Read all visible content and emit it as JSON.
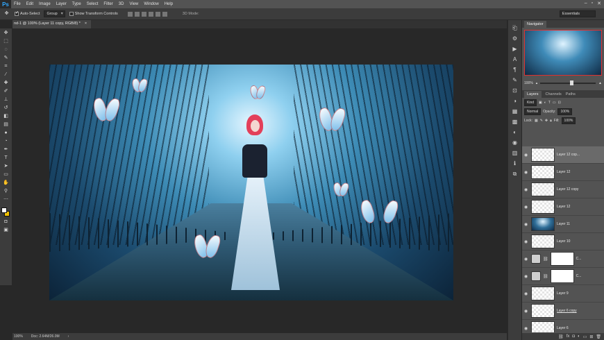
{
  "app": {
    "logo": "Ps",
    "menu": [
      "File",
      "Edit",
      "Image",
      "Layer",
      "Type",
      "Select",
      "Filter",
      "3D",
      "View",
      "Window",
      "Help"
    ],
    "window_controls": [
      "–",
      "▫",
      "✕"
    ]
  },
  "options_bar": {
    "auto_select_label": "Auto-Select",
    "auto_select_mode": "Group",
    "show_transform_label": "Show Transform Controls",
    "mode_3d_label": "3D Mode:",
    "workspace": "Essentials"
  },
  "document": {
    "tab_title": "nd-1 @ 100% (Layer 11 copy, RGB/8) *",
    "tab_close": "×"
  },
  "status": {
    "zoom": "100%",
    "doc_size": "Doc: 2.64M/26.0M"
  },
  "navigator": {
    "tab": "Navigator",
    "zoom": "100%"
  },
  "layers_panel": {
    "tabs": [
      "Layers",
      "Channels",
      "Paths"
    ],
    "filter_kind": "Kind",
    "blend_mode": "Normal",
    "opacity_label": "Opacity:",
    "opacity": "100%",
    "lock_label": "Lock:",
    "fill_label": "Fill:",
    "fill": "100%",
    "layers": [
      {
        "name": "Layer 12 cop...",
        "thumb": "transparent",
        "selected": true
      },
      {
        "name": "Layer 12",
        "thumb": "transparent"
      },
      {
        "name": "Layer 12 copy",
        "thumb": "transparent"
      },
      {
        "name": "Layer 12",
        "thumb": "transparent"
      },
      {
        "name": "Layer 11",
        "thumb": "photo"
      },
      {
        "name": "Layer 10",
        "thumb": "transparent"
      },
      {
        "name": "C...",
        "thumb": "adjust"
      },
      {
        "name": "C...",
        "thumb": "adjust"
      },
      {
        "name": "Layer 9",
        "thumb": "transparent"
      },
      {
        "name": "Layer 6 copy",
        "thumb": "transparent"
      },
      {
        "name": "Layer 6",
        "thumb": "transparent"
      }
    ]
  }
}
